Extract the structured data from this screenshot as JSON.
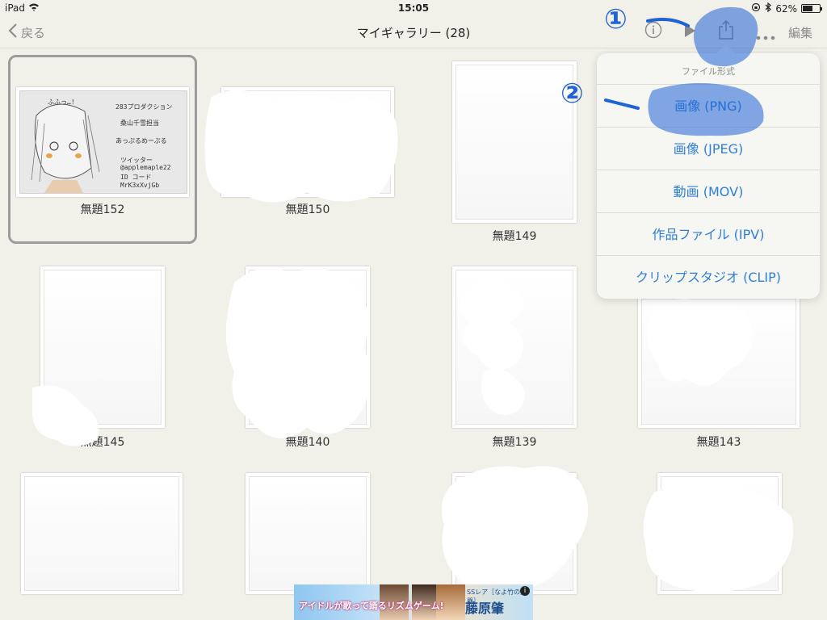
{
  "status_bar": {
    "device": "iPad",
    "time": "15:05",
    "battery": "62%",
    "battery_level": 0.62
  },
  "nav": {
    "back_label": "戻る",
    "title": "マイギャラリー (28)",
    "edit_label": "編集",
    "icons": [
      "info-icon",
      "play-icon",
      "share-icon",
      "more-icon"
    ]
  },
  "gallery": {
    "items": [
      {
        "title": "無題152"
      },
      {
        "title": "無題150"
      },
      {
        "title": "無題149"
      },
      {
        "title": "無題145"
      },
      {
        "title": "無題140"
      },
      {
        "title": "無題139"
      },
      {
        "title": "無題143"
      }
    ],
    "sketch_lines": [
      "ふふっ…!",
      "283プロダクション",
      "桑山千雪担当",
      "あっぷるめーぷる",
      "ツイッター",
      "@applemaple22",
      "ID コード",
      "MrK3xXvjGb"
    ]
  },
  "menu": {
    "header": "ファイル形式",
    "items": [
      "画像 (PNG)",
      "画像 (JPEG)",
      "動画 (MOV)",
      "作品ファイル (IPV)",
      "クリップスタジオ (CLIP)"
    ]
  },
  "annotations": {
    "step1": "①",
    "step2": "②"
  },
  "ad": {
    "line1": "アイドルが歌って踊るリズムゲーム!",
    "tag": "SSレア［なよ竹の美器］",
    "name": "藤原肇",
    "info": "i"
  },
  "colors": {
    "accent": "#2e7fd8",
    "annotation": "#1f63d6",
    "background": "#f1f0e9"
  }
}
